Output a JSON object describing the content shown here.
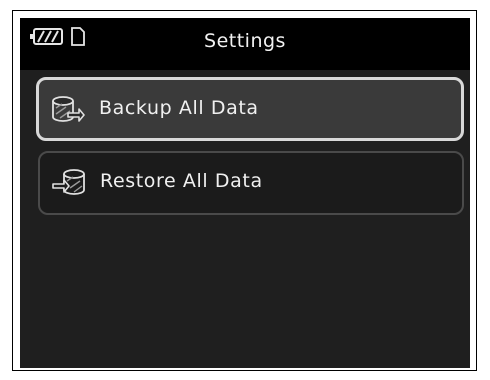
{
  "header": {
    "title": "Settings"
  },
  "status": {
    "icons": [
      "battery-icon",
      "memory-card-icon"
    ]
  },
  "menu": {
    "items": [
      {
        "label": "Backup All Data",
        "icon": "backup-database-icon",
        "selected": true
      },
      {
        "label": "Restore All Data",
        "icon": "restore-database-icon",
        "selected": false
      }
    ]
  },
  "colors": {
    "screen_bg": "#1f1f1f",
    "header_bg": "#000000",
    "selected_border": "#d8d8d8",
    "text": "#f0f0f0"
  }
}
